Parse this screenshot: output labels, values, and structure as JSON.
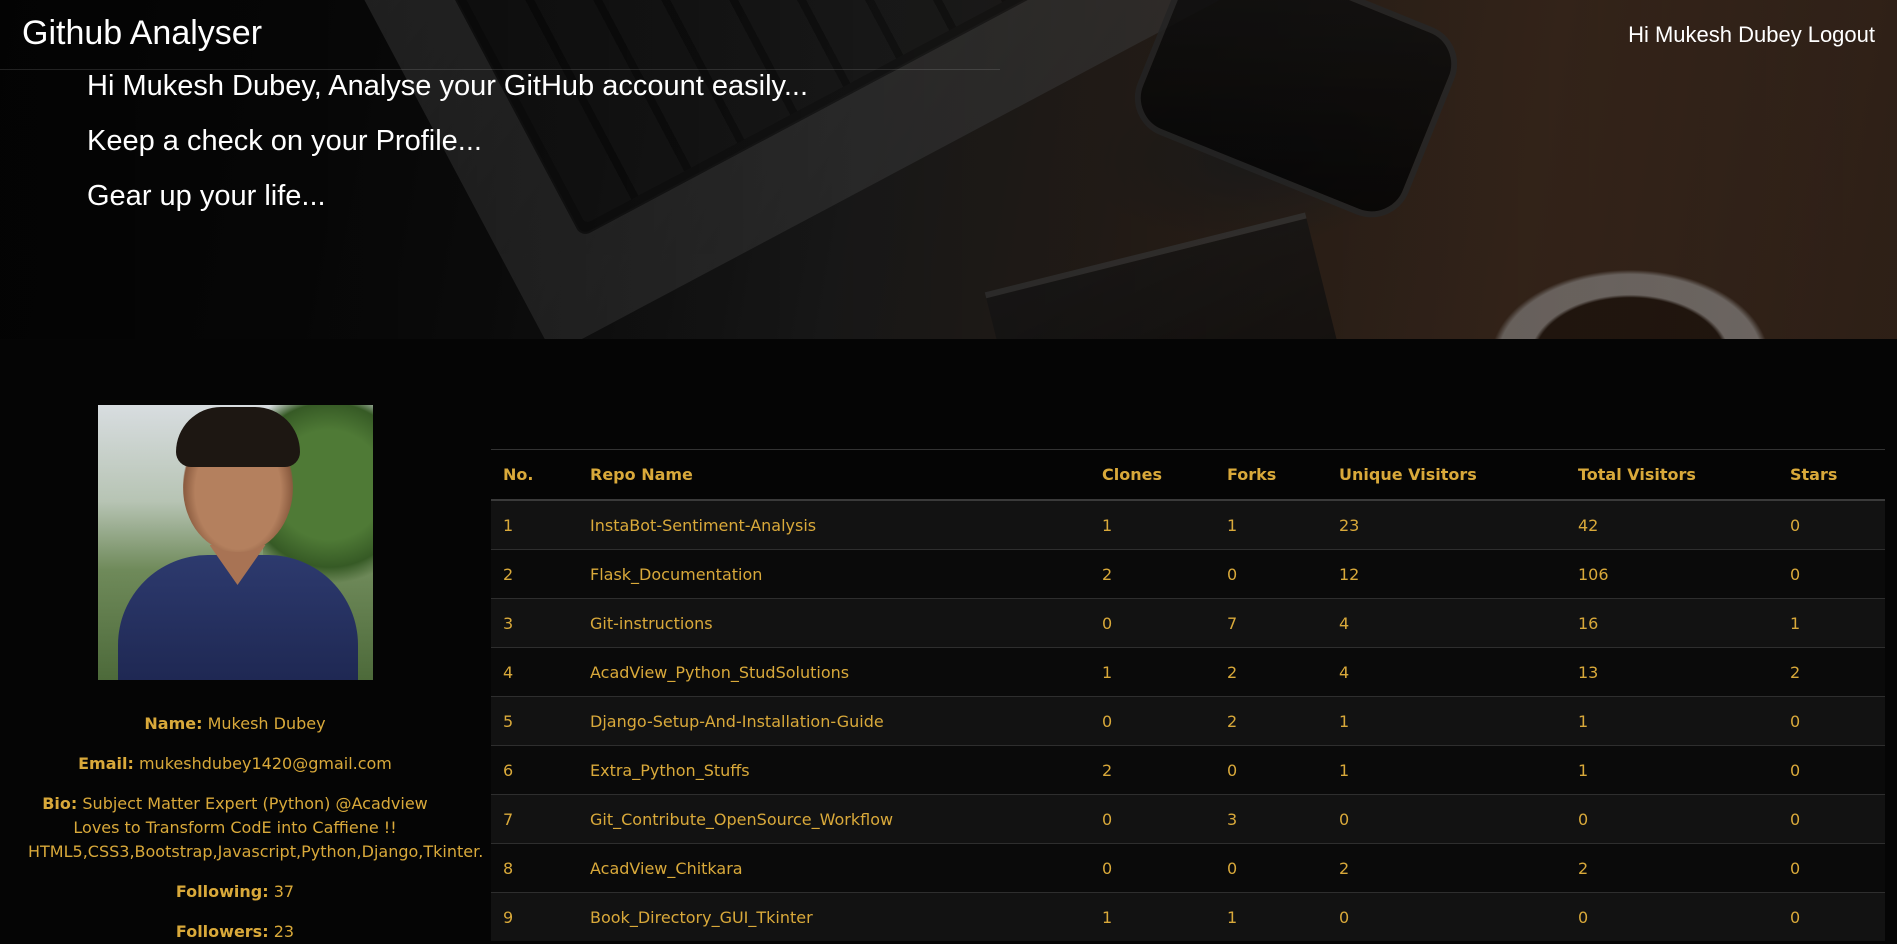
{
  "header": {
    "brand": "Github Analyser",
    "greeting": "Hi Mukesh Dubey",
    "logout_label": "Logout"
  },
  "hero": {
    "taglines": [
      "Hi Mukesh Dubey, Analyse your GitHub account easily...",
      "Keep a check on your Profile...",
      "Gear up your life..."
    ]
  },
  "profile": {
    "name_label": "Name:",
    "name": "Mukesh Dubey",
    "email_label": "Email:",
    "email": "mukeshdubey1420@gmail.com",
    "bio_label": "Bio:",
    "bio": "Subject Matter Expert (Python) @Acadview Loves to Transform CodE into Caffiene !! HTML5,CSS3,Bootstrap,Javascript,Python,Django,Tkinter.",
    "following_label": "Following:",
    "following": "37",
    "followers_label": "Followers:",
    "followers": "23"
  },
  "repo_table": {
    "columns": [
      "No.",
      "Repo Name",
      "Clones",
      "Forks",
      "Unique Visitors",
      "Total Visitors",
      "Stars"
    ],
    "rows": [
      [
        "1",
        "InstaBot-Sentiment-Analysis",
        "1",
        "1",
        "23",
        "42",
        "0"
      ],
      [
        "2",
        "Flask_Documentation",
        "2",
        "0",
        "12",
        "106",
        "0"
      ],
      [
        "3",
        "Git-instructions",
        "0",
        "7",
        "4",
        "16",
        "1"
      ],
      [
        "4",
        "AcadView_Python_StudSolutions",
        "1",
        "2",
        "4",
        "13",
        "2"
      ],
      [
        "5",
        "Django-Setup-And-Installation-Guide",
        "0",
        "2",
        "1",
        "1",
        "0"
      ],
      [
        "6",
        "Extra_Python_Stuffs",
        "2",
        "0",
        "1",
        "1",
        "0"
      ],
      [
        "7",
        "Git_Contribute_OpenSource_Workflow",
        "0",
        "3",
        "0",
        "0",
        "0"
      ],
      [
        "8",
        "AcadView_Chitkara",
        "0",
        "0",
        "2",
        "2",
        "0"
      ],
      [
        "9",
        "Book_Directory_GUI_Tkinter",
        "1",
        "1",
        "0",
        "0",
        "0"
      ]
    ]
  },
  "colors": {
    "accent": "#d9a93a",
    "background": "#050505",
    "hero_text": "#ffffff"
  }
}
